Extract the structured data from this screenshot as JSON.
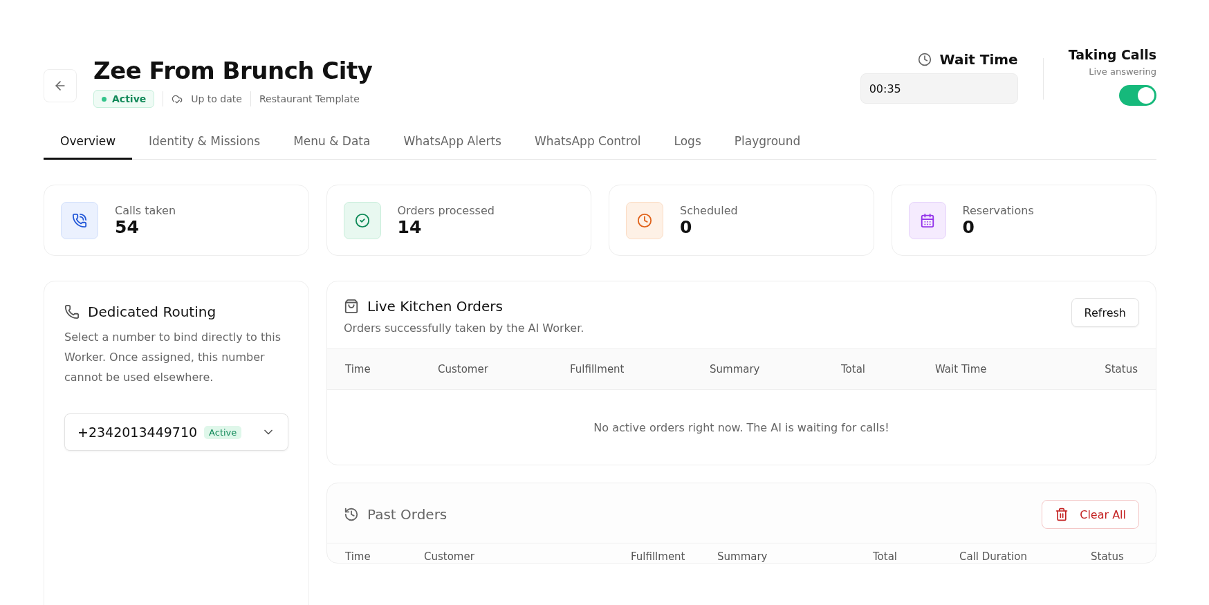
{
  "header": {
    "title": "Zee From Brunch City",
    "status": {
      "label": "Active",
      "active": true
    },
    "sync": "Up to date",
    "template": "Restaurant Template"
  },
  "wait_time": {
    "label": "Wait Time",
    "value": "00:35"
  },
  "taking_calls": {
    "title": "Taking Calls",
    "subtitle": "Live answering",
    "on": true
  },
  "tabs": [
    {
      "label": "Overview",
      "selected": true
    },
    {
      "label": "Identity & Missions",
      "selected": false
    },
    {
      "label": "Menu & Data",
      "selected": false
    },
    {
      "label": "WhatsApp Alerts",
      "selected": false
    },
    {
      "label": "WhatsApp Control",
      "selected": false
    },
    {
      "label": "Logs",
      "selected": false
    },
    {
      "label": "Playground",
      "selected": false
    }
  ],
  "stats": [
    {
      "kind": "calls",
      "label": "Calls taken",
      "value": "54"
    },
    {
      "kind": "orders",
      "label": "Orders processed",
      "value": "14"
    },
    {
      "kind": "scheduled",
      "label": "Scheduled",
      "value": "0"
    },
    {
      "kind": "reservations",
      "label": "Reservations",
      "value": "0"
    }
  ],
  "routing": {
    "title": "Dedicated Routing",
    "description": "Select a number to bind directly to this Worker. Once assigned, this number cannot be used elsewhere.",
    "number": "+2342013449710",
    "badge": "Active"
  },
  "live_orders": {
    "title": "Live Kitchen Orders",
    "subtitle": "Orders successfully taken by the AI Worker.",
    "refresh": "Refresh",
    "columns": [
      "Time",
      "Customer",
      "Fulfillment",
      "Summary",
      "Total",
      "Wait Time",
      "Status"
    ],
    "empty": "No active orders right now. The AI is waiting for calls!"
  },
  "past_orders": {
    "title": "Past Orders",
    "clear": "Clear All",
    "columns": [
      "Time",
      "Customer",
      "Fulfillment",
      "Summary",
      "Total",
      "Call Duration",
      "Status"
    ]
  }
}
